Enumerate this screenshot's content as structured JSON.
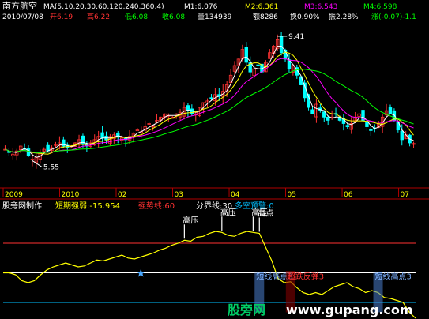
{
  "header": {
    "stock_name": "南方航空",
    "ma_label": "MA(5,10,20,30,60,120,240,360,4)",
    "ma_items": [
      {
        "label": "M1:6.076",
        "color": "#ffffff"
      },
      {
        "label": "M2:6.361",
        "color": "#ffff00"
      },
      {
        "label": "M3:6.543",
        "color": "#ff00ff"
      },
      {
        "label": "M4:6.598",
        "color": "#00ff00"
      }
    ],
    "date": "2010/07/08",
    "open": "开6.19",
    "high": "高6.22",
    "low": "低6.08",
    "close": "收6.08",
    "volume": "量134939",
    "amount": "额8286",
    "turnover": "换0.90%",
    "amplitude": "振2.28%",
    "change": "涨(-0.07)-1.1"
  },
  "indicator_header": {
    "author": "股旁网制作",
    "strength": "短期强弱:-15.954",
    "strong_line": "强势线:60",
    "divider": "分界线:30",
    "warning": "多空预警:0"
  },
  "watermark": {
    "cn": "股旁网",
    "url": "www.gupang.com"
  },
  "colors": {
    "price_up": "#ff3232",
    "price_down": "#00ffff",
    "m1": "#ffffff",
    "m2": "#ffff00",
    "m3": "#ff00ff",
    "m4": "#00ff00",
    "strength_line": "#ffff00",
    "strong_line": "#ff3232",
    "divider_line": "#ffffff",
    "warning_line": "#00bfff"
  },
  "chart_data": [
    {
      "type": "candlestick",
      "x": [
        "2009",
        "2010",
        "02",
        "03",
        "04",
        "05",
        "06",
        "07"
      ],
      "ylim": [
        4.8,
        9.8
      ],
      "annotations": [
        {
          "label": "9.41",
          "value": 9.41,
          "kind": "high"
        },
        {
          "label": "5.55",
          "value": 5.55,
          "kind": "low"
        }
      ],
      "close_trend": [
        5.9,
        5.8,
        5.75,
        5.85,
        6.0,
        5.9,
        5.7,
        5.6,
        5.65,
        5.8,
        5.9,
        5.85,
        5.95,
        6.05,
        6.1,
        6.0,
        5.95,
        6.0,
        6.1,
        6.2,
        6.05,
        6.0,
        6.1,
        6.2,
        6.3,
        6.25,
        6.2,
        6.3,
        6.35,
        6.3,
        6.25,
        6.2,
        6.3,
        6.4,
        6.5,
        6.45,
        6.6,
        6.7,
        6.65,
        6.8,
        6.9,
        7.0,
        6.95,
        6.9,
        7.0,
        7.05,
        7.2,
        7.1,
        7.0,
        7.05,
        7.2,
        7.35,
        7.4,
        7.5,
        7.6,
        7.55,
        7.7,
        7.9,
        8.2,
        8.5,
        8.7,
        9.0,
        8.6,
        8.3,
        8.4,
        8.5,
        8.3,
        8.6,
        8.9,
        9.1,
        9.3,
        8.9,
        8.7,
        8.4,
        8.5,
        8.2,
        7.9,
        7.5,
        7.2,
        7.0,
        7.3,
        7.1,
        6.9,
        6.8,
        6.9,
        7.0,
        6.8,
        6.7,
        6.6,
        6.7,
        6.9,
        7.0,
        6.8,
        6.6,
        6.5,
        6.55,
        6.7,
        6.9,
        7.1,
        7.0,
        6.8,
        6.5,
        6.2,
        6.35,
        6.1,
        6.08
      ]
    },
    {
      "type": "line",
      "series": [
        {
          "name": "短期强弱",
          "values": [
            30,
            30,
            28,
            22,
            20,
            22,
            28,
            33,
            36,
            38,
            40,
            38,
            36,
            37,
            40,
            43,
            42,
            44,
            46,
            48,
            45,
            44,
            46,
            48,
            50,
            53,
            55,
            58,
            60,
            63,
            62,
            66,
            67,
            70,
            72,
            71,
            68,
            67,
            70,
            72,
            71,
            70,
            56,
            42,
            24,
            20,
            21,
            15,
            10,
            8,
            10,
            8,
            12,
            16,
            18,
            20,
            16,
            14,
            10,
            12,
            10,
            5,
            4,
            2,
            0,
            -10,
            -15.954
          ]
        }
      ],
      "reference_lines": [
        {
          "name": "强势线",
          "value": 60
        },
        {
          "name": "分界线",
          "value": 30
        },
        {
          "name": "多空预警",
          "value": 0
        }
      ],
      "ylim": [
        -12,
        92
      ],
      "signals": [
        {
          "label": "高压",
          "index": 29
        },
        {
          "label": "高压",
          "index": 35
        },
        {
          "label": "高压",
          "index": 40
        },
        {
          "label": "高点",
          "index": 41
        },
        {
          "label": "短线高点3",
          "index": 41
        },
        {
          "label": "超跌反弹3",
          "index": 46
        },
        {
          "label": "短线高点3",
          "index": 60
        }
      ]
    }
  ]
}
